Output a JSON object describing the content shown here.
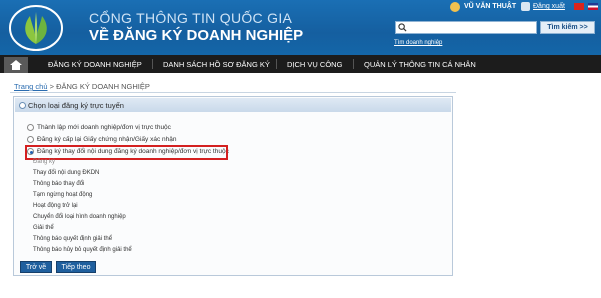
{
  "header": {
    "title_line1": "CỔNG THÔNG TIN QUỐC GIA",
    "title_line2": "VỀ ĐĂNG KÝ DOANH NGHIỆP",
    "user_name": "VŨ VĂN THUẬT",
    "logout_label": "Đăng xuất",
    "search_placeholder": "",
    "search_button": "Tìm kiếm >>",
    "advanced_search": "Tìm doanh nghiệp"
  },
  "nav": {
    "items": [
      "ĐĂNG KÝ DOANH NGHIỆP",
      "DANH SÁCH HỒ SƠ ĐĂNG KÝ",
      "DỊCH VỤ CÔNG",
      "QUẢN LÝ THÔNG TIN CÁ NHÂN"
    ]
  },
  "breadcrumb": {
    "home": "Trang chủ",
    "separator": " > ",
    "current": "ĐĂNG KÝ DOANH NGHIỆP"
  },
  "panel": {
    "title": "Chọn loại đăng ký trực tuyến",
    "options": [
      {
        "label": "Thành lập mới doanh nghiệp/đơn vị trực thuộc",
        "checked": false
      },
      {
        "label": "Đăng ký cấp lại Giấy chứng nhận/Giấy xác nhận",
        "checked": false
      },
      {
        "label": "Đăng ký thay đổi nội dung đăng ký doanh nghiệp/đơn vị trực thuộc",
        "checked": true
      }
    ],
    "sub_items": [
      "Đăng ký",
      "Thay đổi nội dung ĐKDN",
      "Thông báo thay đổi",
      "Tạm ngừng hoạt động",
      "Hoạt động trở lại",
      "Chuyển đổi loại hình doanh nghiệp",
      "Giải thể",
      "Thông báo quyết định giải thể",
      "Thông báo hủy bỏ quyết định giải thể"
    ],
    "back_button": "Trở về",
    "next_button": "Tiếp theo"
  },
  "colors": {
    "header_blue": "#1a6fb4",
    "nav_dark": "#1c1c1c",
    "highlight_red": "#d42020",
    "button_blue": "#1f5f9e"
  }
}
